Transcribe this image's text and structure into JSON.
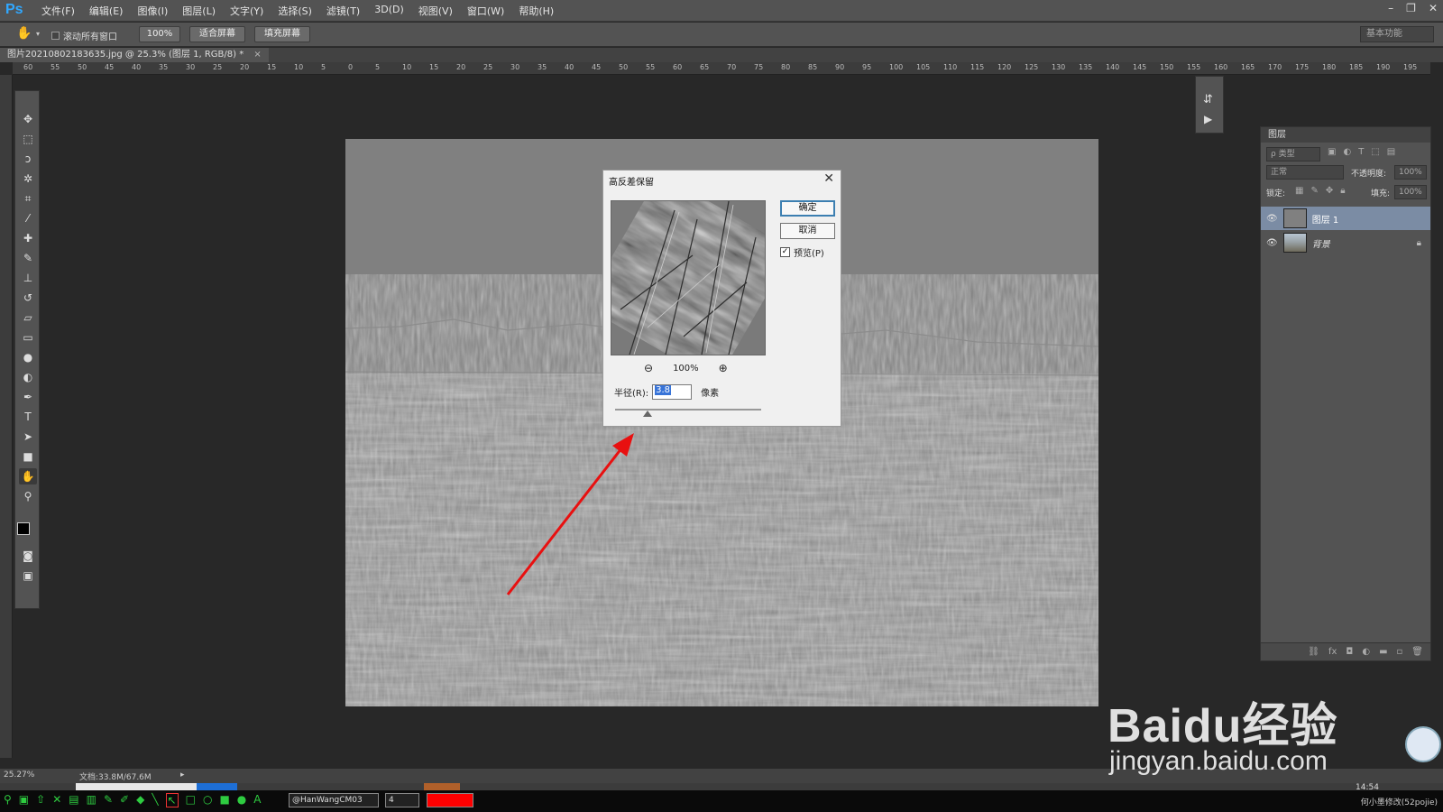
{
  "app": {
    "logo": "Ps"
  },
  "menu": [
    "文件(F)",
    "编辑(E)",
    "图像(I)",
    "图层(L)",
    "文字(Y)",
    "选择(S)",
    "滤镜(T)",
    "3D(D)",
    "视图(V)",
    "窗口(W)",
    "帮助(H)"
  ],
  "window_controls": [
    "–",
    "❐",
    "✕"
  ],
  "options_bar": {
    "scroll_all_label": "滚动所有窗口",
    "zoom_btn": "100%",
    "fit_screen_btn": "适合屏幕",
    "fill_screen_btn": "填充屏幕",
    "workspace": "基本功能"
  },
  "document_tab": "图片20210802183635.jpg @ 25.3% (图层 1, RGB/8) *",
  "ruler_top_ticks": [
    "60",
    "55",
    "50",
    "45",
    "40",
    "35",
    "30",
    "25",
    "20",
    "15",
    "10",
    "5",
    "0",
    "5",
    "10",
    "15",
    "20",
    "25",
    "30",
    "35",
    "40",
    "45",
    "50",
    "55",
    "60",
    "65",
    "70",
    "75",
    "80",
    "85",
    "90",
    "95",
    "100",
    "105",
    "110",
    "115",
    "120",
    "125",
    "130",
    "135",
    "140",
    "145",
    "150",
    "155",
    "160",
    "165",
    "170",
    "175",
    "180",
    "185",
    "190",
    "195"
  ],
  "dialog": {
    "title": "高反差保留",
    "ok": "确定",
    "cancel": "取消",
    "preview_label": "预览(P)",
    "preview_checked": true,
    "zoom_level": "100%",
    "radius_label": "半径(R):",
    "radius_value": "3.8",
    "radius_unit": "像素"
  },
  "layers_panel": {
    "title": "图层",
    "filter_kind": "ρ 类型",
    "blend_mode": "正常",
    "opacity_label": "不透明度:",
    "opacity_value": "100%",
    "lock_label": "锁定:",
    "fill_label": "填充:",
    "fill_value": "100%",
    "layers": [
      {
        "name": "图层 1",
        "selected": true
      },
      {
        "name": "背景",
        "selected": false,
        "locked": true
      }
    ]
  },
  "status_bar": {
    "zoom": "25.27%",
    "doc_info": "文档:33.8M/67.6M"
  },
  "taskbar": {
    "font_name": "@HanWangCM03",
    "size": "4",
    "clock": "14:54",
    "credit": "何小墨修改(52pojie)"
  },
  "watermark": {
    "brand": "Baidu经验",
    "url": "jingyan.baidu.com"
  },
  "colors": {
    "accent_blue": "#31a8ff",
    "arrow_red": "#e81010",
    "selected_layer": "#7b8ca4"
  }
}
